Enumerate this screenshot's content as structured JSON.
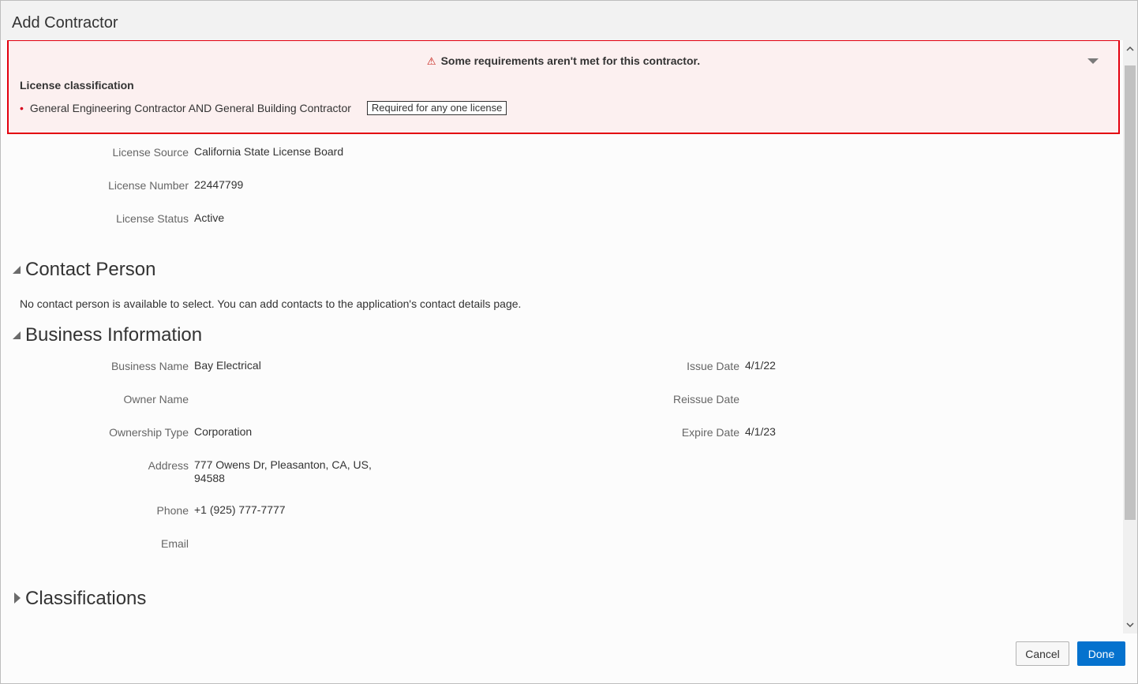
{
  "dialog": {
    "title": "Add Contractor",
    "cancel_label": "Cancel",
    "done_label": "Done"
  },
  "banner": {
    "warning_icon": "warning-triangle-icon",
    "heading": "Some requirements aren't met for this contractor.",
    "subtitle": "License classification",
    "item_text": "General Engineering Contractor AND General Building Contractor",
    "item_badge": "Required for any one license",
    "accent_color": "#e3000f"
  },
  "license": {
    "source_label": "License Source",
    "source_value": "California State License Board",
    "number_label": "License Number",
    "number_value": "22447799",
    "status_label": "License Status",
    "status_value": "Active"
  },
  "contact_person": {
    "title": "Contact Person",
    "message": "No contact person is available to select. You can add contacts to the application's contact details page."
  },
  "business": {
    "title": "Business Information",
    "business_name_label": "Business Name",
    "business_name_value": "Bay Electrical",
    "owner_name_label": "Owner Name",
    "owner_name_value": "",
    "ownership_type_label": "Ownership Type",
    "ownership_type_value": "Corporation",
    "address_label": "Address",
    "address_line1": "777 Owens Dr, Pleasanton, CA, US,",
    "address_line2": "94588",
    "phone_label": "Phone",
    "phone_value": "+1 (925) 777-7777",
    "email_label": "Email",
    "email_value": "",
    "issue_date_label": "Issue Date",
    "issue_date_value": "4/1/22",
    "reissue_date_label": "Reissue Date",
    "reissue_date_value": "",
    "expire_date_label": "Expire Date",
    "expire_date_value": "4/1/23"
  },
  "classifications": {
    "title": "Classifications"
  },
  "colors": {
    "primary_button": "#0572ce"
  }
}
